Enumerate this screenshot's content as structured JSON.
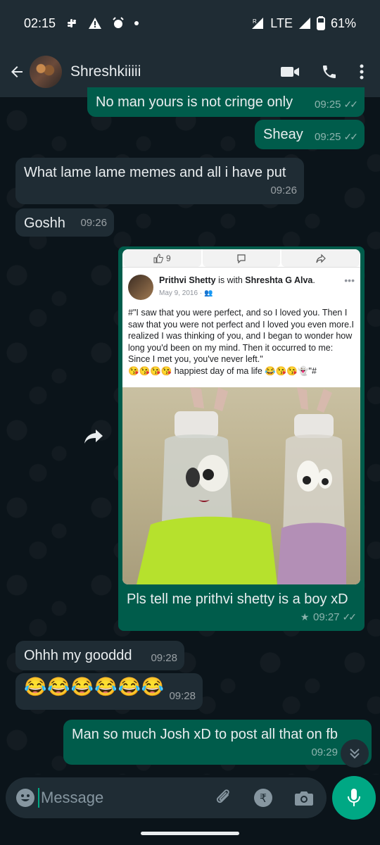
{
  "status_bar": {
    "time": "02:15",
    "network": "LTE",
    "battery": "61%"
  },
  "header": {
    "contact_name": "Shreshkiiiii"
  },
  "messages": [
    {
      "dir": "out",
      "text": "No man yours is not cringe only",
      "time": "09:25"
    },
    {
      "dir": "out",
      "text": "Sheay",
      "time": "09:25"
    },
    {
      "dir": "in",
      "text": "What lame lame memes and all i have put",
      "time": "09:26"
    },
    {
      "dir": "in",
      "text": "Goshh",
      "time": "09:26"
    },
    {
      "dir": "out",
      "text": "Pls tell me prithvi shetty is a boy xD",
      "time": "09:27",
      "starred": true
    },
    {
      "dir": "in",
      "text": "Ohhh my gooddd",
      "time": "09:28"
    },
    {
      "dir": "in",
      "text": "😂😂😂😂😂😂",
      "time": "09:28"
    },
    {
      "dir": "out",
      "text": "Man so much Josh xD to post all that on fb",
      "time": "09:29"
    }
  ],
  "fb_post": {
    "like_count": "9",
    "author": "Prithvi Shetty",
    "with_text": "is with",
    "tagged": "Shreshta G Alva",
    "date": "May 9, 2016 ·",
    "body": "#\"I saw that you were perfect, and so I loved you. Then I saw that you were not perfect and I loved you even more.I realized I was thinking of you, and I began to wonder how long you'd been on my mind. Then it occurred to me: Since I met you, you've never left.\"",
    "body_end": "😘😘😘😘 happiest day of ma life 😂😘😘👻\"#"
  },
  "composer": {
    "placeholder": "Message"
  },
  "colors": {
    "incoming": "#1f2c34",
    "outgoing": "#005c4b",
    "accent": "#00a884",
    "background": "#0b141a"
  },
  "icons": [
    "back-arrow-icon",
    "video-call-icon",
    "phone-icon",
    "more-vert-icon",
    "forward-icon",
    "emoji-icon",
    "attach-icon",
    "rupee-icon",
    "camera-icon",
    "mic-icon",
    "chevron-down-icon",
    "star-icon",
    "double-check-icon"
  ]
}
